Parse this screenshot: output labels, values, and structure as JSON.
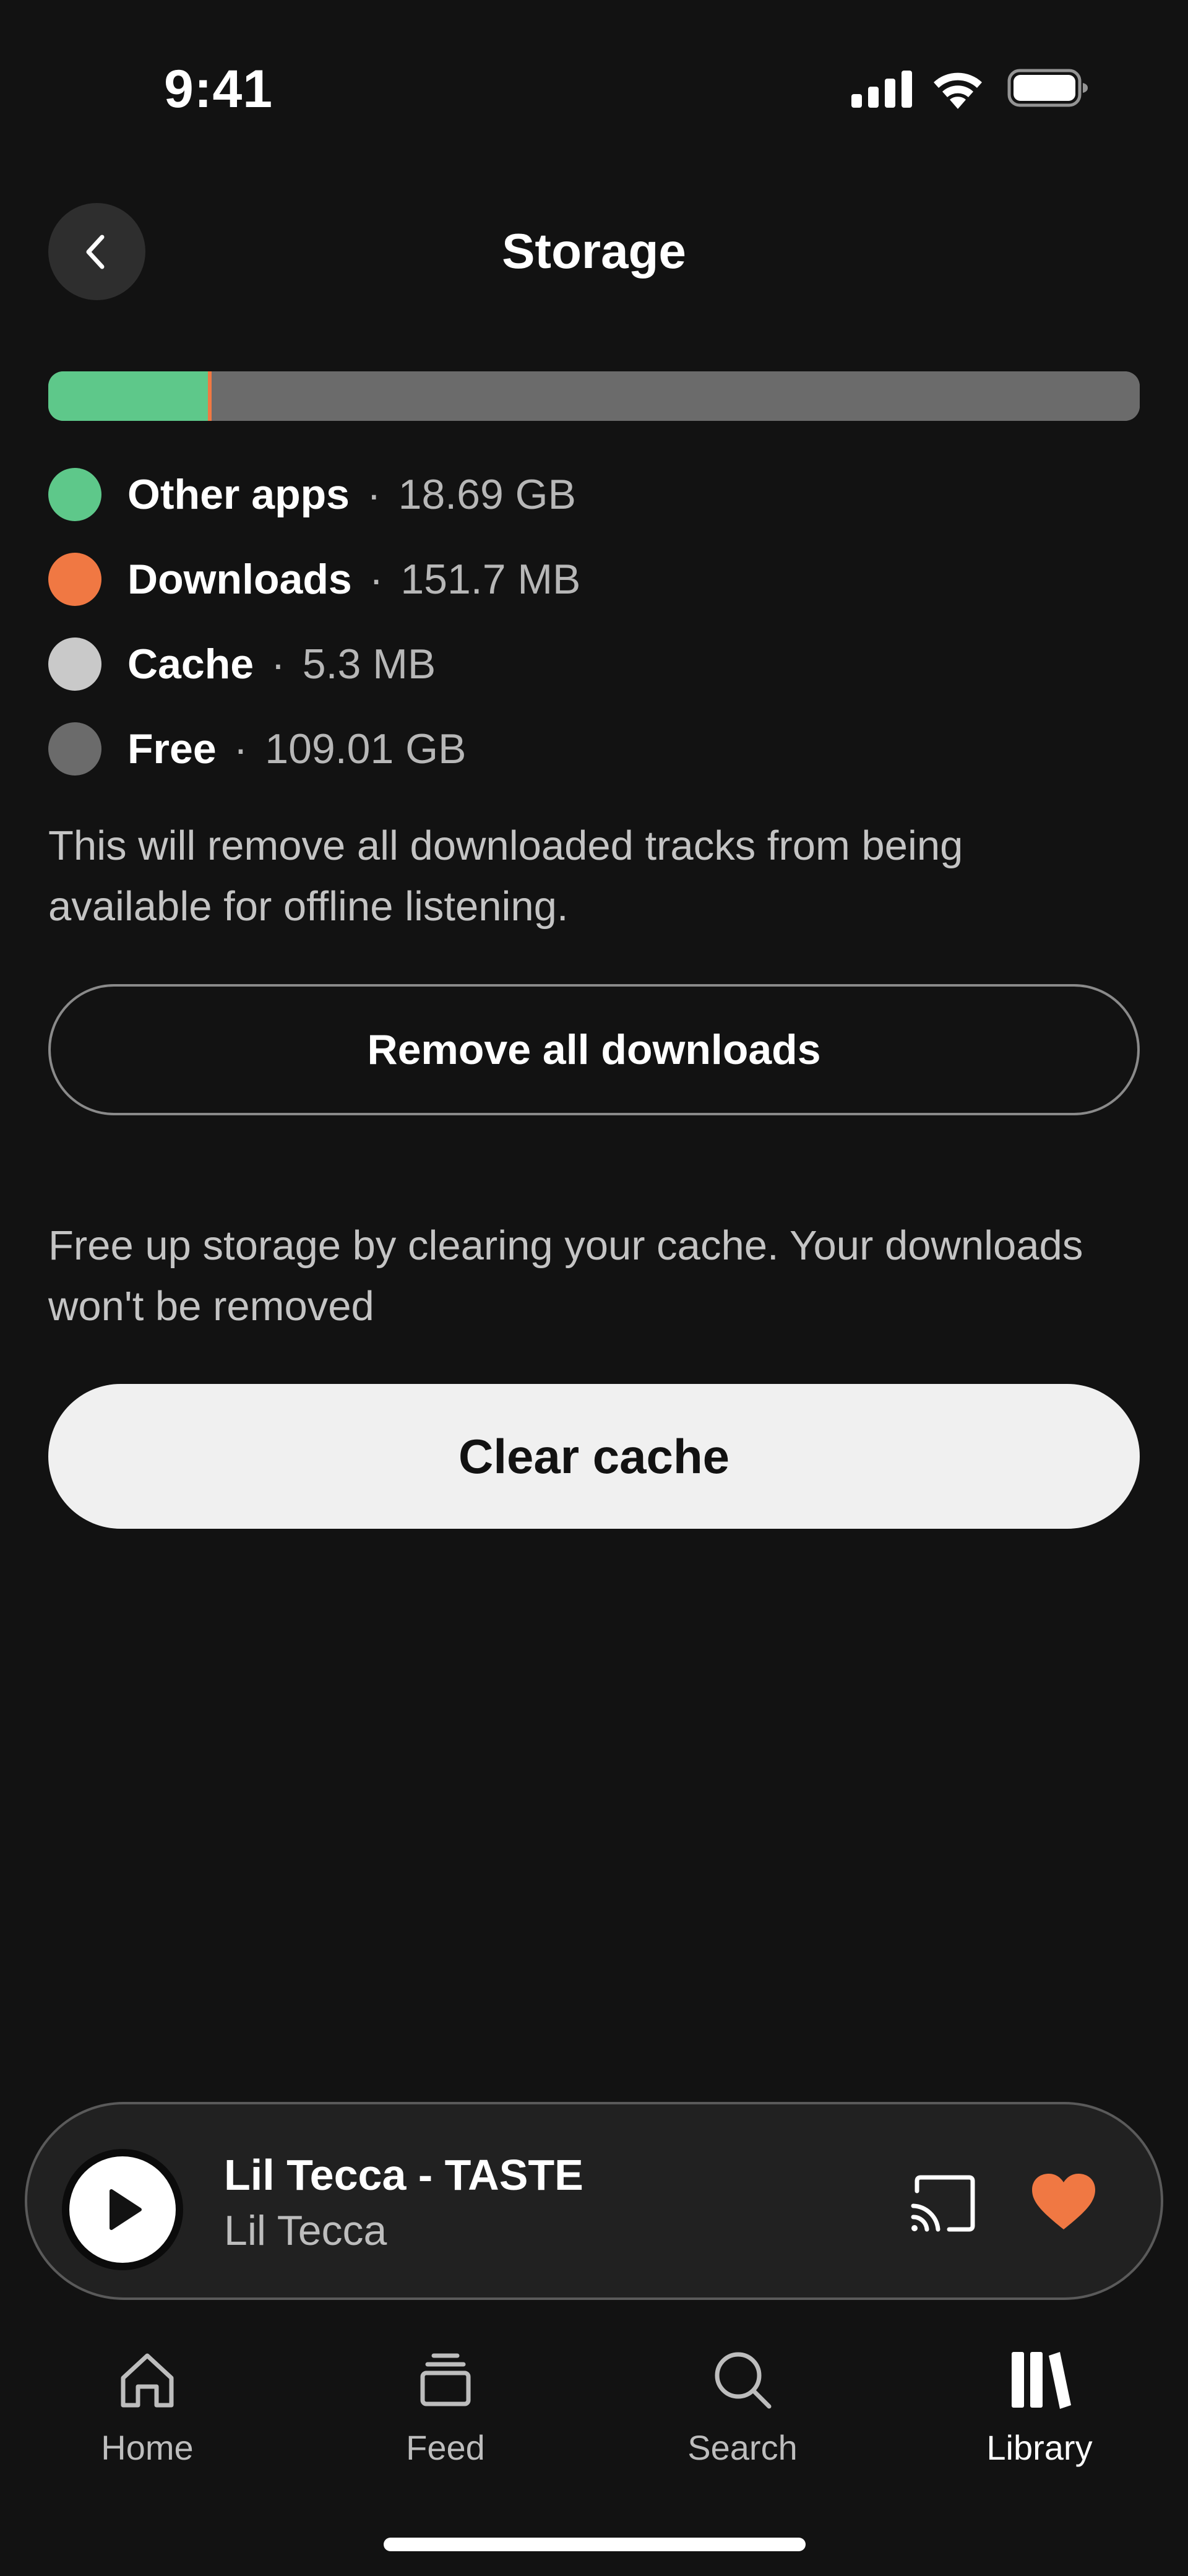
{
  "status_bar": {
    "time": "9:41"
  },
  "header": {
    "title": "Storage"
  },
  "storage": {
    "bar": [
      {
        "name": "Other apps",
        "color": "#5ec88a",
        "fraction": 0.146
      },
      {
        "name": "Downloads",
        "color": "#f07843",
        "fraction": 0.0035
      },
      {
        "name": "Cache",
        "color": "#c9c9c9",
        "fraction": 0.0002
      },
      {
        "name": "Free",
        "color": "#6b6b6b",
        "fraction": 0.8503
      }
    ],
    "legend": [
      {
        "label": "Other apps",
        "size": "18.69 GB",
        "color": "#5ec88a"
      },
      {
        "label": "Downloads",
        "size": "151.7 MB",
        "color": "#f07843"
      },
      {
        "label": "Cache",
        "size": "5.3 MB",
        "color": "#c9c9c9"
      },
      {
        "label": "Free",
        "size": "109.01 GB",
        "color": "#6b6b6b"
      }
    ],
    "separator": "·"
  },
  "downloads_section": {
    "description": "This will remove all downloaded tracks from being available for offline listening.",
    "button_label": "Remove all downloads"
  },
  "cache_section": {
    "description": "Free up storage by clearing your cache. Your downloads won't be removed",
    "button_label": "Clear cache"
  },
  "player": {
    "title": "Lil Tecca - TASTE",
    "artist": "Lil Tecca",
    "heart_color": "#f07843",
    "icons": [
      "play-icon",
      "cast-icon",
      "heart-icon"
    ]
  },
  "tabs": [
    {
      "label": "Home",
      "icon": "home-icon"
    },
    {
      "label": "Feed",
      "icon": "feed-icon"
    },
    {
      "label": "Search",
      "icon": "search-icon"
    },
    {
      "label": "Library",
      "icon": "library-icon",
      "active": true
    }
  ]
}
